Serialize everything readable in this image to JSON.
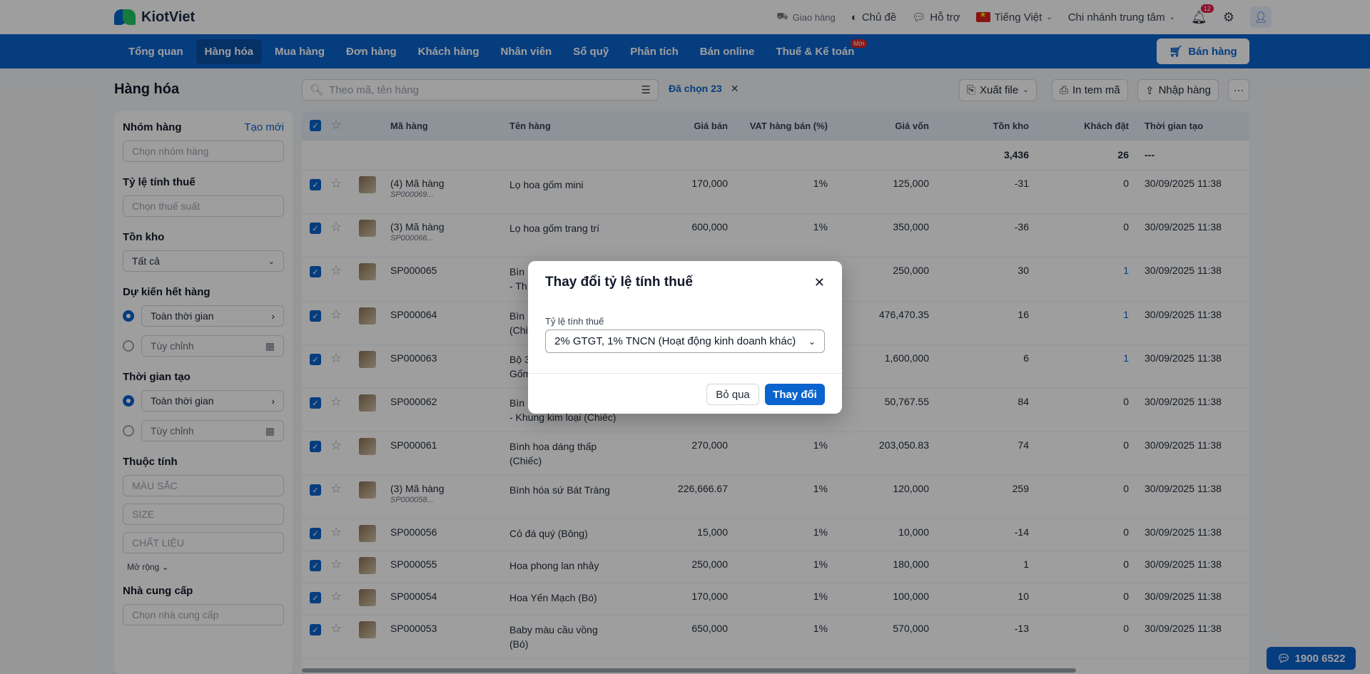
{
  "header": {
    "logo_text": "KiotViet",
    "delivery": "Giao hàng",
    "theme": "Chủ đề",
    "support": "Hỗ trợ",
    "language": "Tiếng Việt",
    "branch": "Chi nhánh trung tâm",
    "notif_count": "12"
  },
  "nav": {
    "items": [
      "Tổng quan",
      "Hàng hóa",
      "Mua hàng",
      "Đơn hàng",
      "Khách hàng",
      "Nhân viên",
      "Sổ quỹ",
      "Phân tích",
      "Bán online",
      "Thuế & Kế toán"
    ],
    "new_badge": "Mới",
    "sell_button": "Bán hàng"
  },
  "page": {
    "title": "Hàng hóa"
  },
  "sidebar": {
    "group_title": "Nhóm hàng",
    "group_create": "Tạo mới",
    "group_placeholder": "Chọn nhóm hàng",
    "tax_title": "Tỷ lệ tính thuế",
    "tax_placeholder": "Chọn thuế suất",
    "stock_title": "Tồn kho",
    "stock_value": "Tất cả",
    "outstock_title": "Dự kiến hết hàng",
    "all_time": "Toàn thời gian",
    "custom": "Tùy chỉnh",
    "created_title": "Thời gian tạo",
    "attr_title": "Thuộc tính",
    "attr_color": "MÀU SẮC",
    "attr_size": "SIZE",
    "attr_material": "CHẤT LIỆU",
    "expand": "Mở rộng",
    "supplier_title": "Nhà cung cấp",
    "supplier_placeholder": "Chọn nhà cung cấp"
  },
  "toolbar": {
    "search_placeholder": "Theo mã, tên hàng",
    "selected": "Đã chọn 23",
    "export": "Xuất file",
    "print": "In tem mã",
    "import": "Nhập hàng",
    "more": "···"
  },
  "table": {
    "columns": [
      "Mã hàng",
      "Tên hàng",
      "Giá bán",
      "VAT hàng bán (%)",
      "Giá vốn",
      "Tồn kho",
      "Khách đặt",
      "Thời gian tạo"
    ],
    "summary": {
      "stock": "3,436",
      "ordered": "26",
      "created": "---"
    },
    "rows": [
      {
        "code": "(4) Mã hàng",
        "sub": "SP000069...",
        "name": "Lọ hoa gốm mini",
        "name2": "",
        "price": "170,000",
        "vat": "1%",
        "cost": "125,000",
        "stock": "-31",
        "ordered": "0",
        "created": "30/09/2025 11:38"
      },
      {
        "code": "(3) Mã hàng",
        "sub": "SP000066...",
        "name": "Lọ hoa gốm trang trí",
        "name2": "",
        "price": "600,000",
        "vat": "1%",
        "cost": "350,000",
        "stock": "-36",
        "ordered": "0",
        "created": "30/09/2025 11:38"
      },
      {
        "code": "SP000065",
        "sub": "",
        "name": "Bìn",
        "name2": "- Th",
        "price": "",
        "vat": "",
        "cost": "250,000",
        "stock": "30",
        "ordered": "1",
        "created": "30/09/2025 11:38"
      },
      {
        "code": "SP000064",
        "sub": "",
        "name": "Bìn",
        "name2": "(Chi",
        "price": "",
        "vat": "",
        "cost": "476,470.35",
        "stock": "16",
        "ordered": "1",
        "created": "30/09/2025 11:38"
      },
      {
        "code": "SP000063",
        "sub": "",
        "name": "Bộ 3",
        "name2": "Gốm",
        "price": "",
        "vat": "",
        "cost": "1,600,000",
        "stock": "6",
        "ordered": "1",
        "created": "30/09/2025 11:38"
      },
      {
        "code": "SP000062",
        "sub": "",
        "name": "Bìn",
        "name2": "- Khung kim loại (Chiếc)",
        "price": "",
        "vat": "",
        "cost": "50,767.55",
        "stock": "84",
        "ordered": "0",
        "created": "30/09/2025 11:38"
      },
      {
        "code": "SP000061",
        "sub": "",
        "name": "Bình hoa dáng thấp",
        "name2": "(Chiếc)",
        "price": "270,000",
        "vat": "1%",
        "cost": "203,050.83",
        "stock": "74",
        "ordered": "0",
        "created": "30/09/2025 11:38"
      },
      {
        "code": "(3) Mã hàng",
        "sub": "SP000058...",
        "name": "Bình hóa sứ Bát Tràng",
        "name2": "",
        "price": "226,666.67",
        "vat": "1%",
        "cost": "120,000",
        "stock": "259",
        "ordered": "0",
        "created": "30/09/2025 11:38"
      },
      {
        "code": "SP000056",
        "sub": "",
        "name": "Cỏ đá quý (Bông)",
        "name2": "",
        "price": "15,000",
        "vat": "1%",
        "cost": "10,000",
        "stock": "-14",
        "ordered": "0",
        "created": "30/09/2025 11:38"
      },
      {
        "code": "SP000055",
        "sub": "",
        "name": "Hoa phong lan nhảy",
        "name2": "",
        "price": "250,000",
        "vat": "1%",
        "cost": "180,000",
        "stock": "1",
        "ordered": "0",
        "created": "30/09/2025 11:38"
      },
      {
        "code": "SP000054",
        "sub": "",
        "name": "Hoa Yến Mạch (Bó)",
        "name2": "",
        "price": "170,000",
        "vat": "1%",
        "cost": "100,000",
        "stock": "10",
        "ordered": "0",
        "created": "30/09/2025 11:38"
      },
      {
        "code": "SP000053",
        "sub": "",
        "name": "Baby màu cầu vồng",
        "name2": "(Bó)",
        "price": "650,000",
        "vat": "1%",
        "cost": "570,000",
        "stock": "-13",
        "ordered": "0",
        "created": "30/09/2025 11:38"
      }
    ]
  },
  "chat": {
    "phone": "1900 6522"
  },
  "modal": {
    "title": "Thay đổi tỷ lệ tính thuế",
    "label": "Tỷ lệ tính thuế",
    "value": "2% GTGT, 1% TNCN (Hoạt động kinh doanh khác)",
    "cancel": "Bỏ qua",
    "confirm": "Thay đổi"
  },
  "colors": {
    "primary": "#0b63ce",
    "nav_bg": "#0b63ce",
    "nav_active": "#0a4fa6"
  }
}
